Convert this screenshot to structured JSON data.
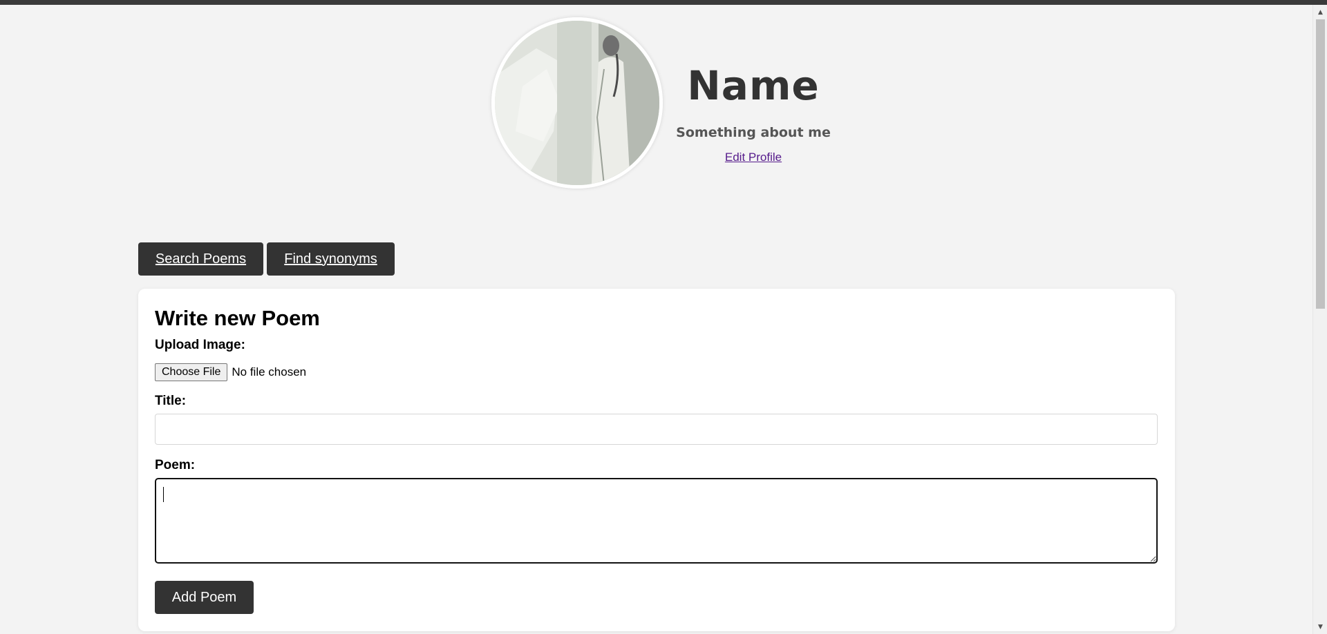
{
  "profile": {
    "avatar_icon": "profile-photo",
    "name": "Name",
    "bio": "Something about me",
    "edit_link": "Edit Profile"
  },
  "tools": {
    "search_label": "Search Poems",
    "synonyms_label": "Find synonyms"
  },
  "form": {
    "heading": "Write new Poem",
    "upload_label": "Upload Image:",
    "file_button": "Choose File",
    "file_status": "No file chosen",
    "title_label": "Title:",
    "title_value": "",
    "poem_label": "Poem:",
    "poem_value": "",
    "submit_label": "Add Poem"
  },
  "colors": {
    "page_bg": "#f3f3f3",
    "button_bg": "#333333",
    "card_bg": "#ffffff",
    "link": "#551a8b"
  }
}
